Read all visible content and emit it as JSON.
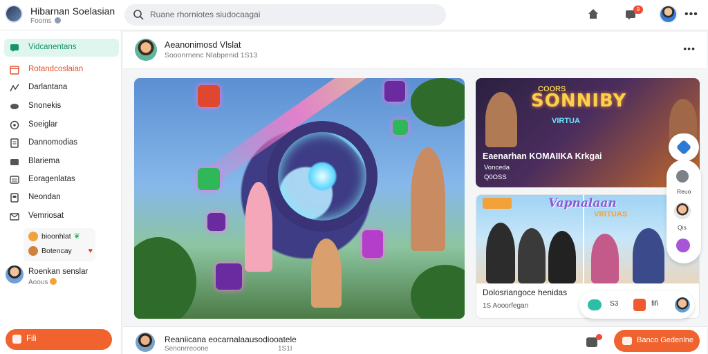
{
  "header": {
    "brand_title": "Hibarnan Soelasian",
    "brand_sub": "Fooms",
    "search_placeholder": "Ruane rhorniotes siudocaagai",
    "notification_count": "9"
  },
  "sidebar": {
    "items": [
      {
        "label": "Vidcanentans",
        "icon": "chat-icon",
        "active": true
      },
      {
        "label": "Rotandcoslaian",
        "icon": "calendar-icon",
        "highlight": true
      },
      {
        "label": "Darlantana",
        "icon": "trend-icon"
      },
      {
        "label": "Snonekis",
        "icon": "controller-icon"
      },
      {
        "label": "Soeiglar",
        "icon": "compass-icon"
      },
      {
        "label": "Dannomodias",
        "icon": "document-icon"
      },
      {
        "label": "Blariema",
        "icon": "card-icon"
      },
      {
        "label": "Eoragenlatas",
        "icon": "list-icon"
      },
      {
        "label": "Neondan",
        "icon": "book-icon"
      },
      {
        "label": "Vemriosat",
        "icon": "mail-icon"
      }
    ],
    "promo": {
      "line1": "bioonhlat",
      "line2": "Botencay"
    },
    "user": {
      "name": "Roenkan senslar",
      "sub": "Aoous"
    },
    "fab_label": "Fili"
  },
  "post": {
    "title": "Aeanonimosd Vlslat",
    "meta": "Sooonrnenc Nlabpenid 1S13"
  },
  "card_top": {
    "banner": "SONNIBY",
    "banner_small": "COORS",
    "banner_sub": "VIRTUA",
    "title": "Eaenarhan KOMAIIKA Krkgai",
    "sub1": "Vonceda",
    "sub2": "Q0OSS"
  },
  "card_bottom": {
    "banner": "Vapnalaan",
    "banner_sub": "VIRTUAS",
    "title": "Dolosriangoce henidas",
    "meta": "1S Aooorfegan"
  },
  "floating": {
    "label1": "Reuo",
    "label2": "Qis"
  },
  "chat_pill": {
    "label1": "S3",
    "label2": "fifi"
  },
  "post2": {
    "title": "Reaniicana eocarnalaausodiooatele",
    "meta": "Senonrreoone",
    "meta_right": "1S1I"
  },
  "fab_right_label": "Banco Gedenlne"
}
